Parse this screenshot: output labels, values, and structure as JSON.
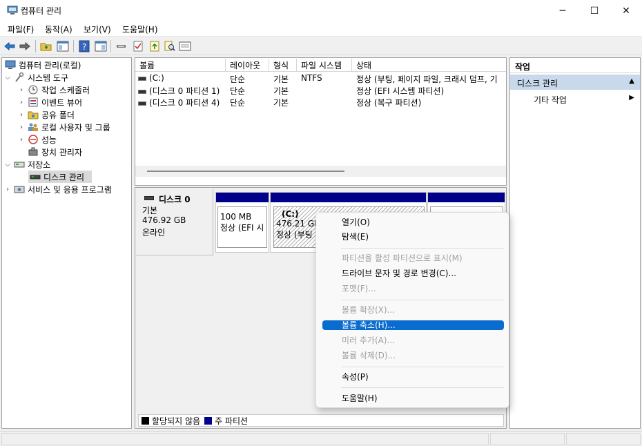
{
  "window": {
    "title": "컴퓨터 관리",
    "minimize_glyph": "─",
    "maximize_glyph": "☐",
    "close_glyph": "✕"
  },
  "menu": [
    "파일(F)",
    "동작(A)",
    "보기(V)",
    "도움말(H)"
  ],
  "tree": {
    "root": "컴퓨터 관리(로컬)",
    "system_tools": "시스템 도구",
    "task_scheduler": "작업 스케줄러",
    "event_viewer": "이벤트 뷰어",
    "shared_folders": "공유 폴더",
    "local_users": "로컬 사용자 및 그룹",
    "performance": "성능",
    "device_manager": "장치 관리자",
    "storage": "저장소",
    "disk_management": "디스크 관리",
    "services": "서비스 및 응용 프로그램"
  },
  "volume_table": {
    "columns": [
      "볼륨",
      "레이아웃",
      "형식",
      "파일 시스템",
      "상태"
    ],
    "rows": [
      [
        "(C:)",
        "단순",
        "기본",
        "NTFS",
        "정상 (부팅, 페이지 파일, 크래시 덤프, 기"
      ],
      [
        "(디스크 0 파티션 1)",
        "단순",
        "기본",
        "",
        "정상 (EFI 시스템 파티션)"
      ],
      [
        "(디스크 0 파티션 4)",
        "단순",
        "기본",
        "",
        "정상 (복구 파티션)"
      ]
    ]
  },
  "disk": {
    "name": "디스크 0",
    "type": "기본",
    "size": "476.92 GB",
    "status": "온라인",
    "partitions": [
      {
        "title": "",
        "size": "100 MB",
        "status": "정상 (EFI 시"
      },
      {
        "title": "(C:)",
        "size": "476.21 GB",
        "status": "정상 (부팅"
      },
      {
        "title": "",
        "size": "",
        "status": ""
      }
    ]
  },
  "legend": {
    "unallocated": "할당되지 않음",
    "primary": "주 파티션",
    "unallocated_color": "#000000",
    "primary_color": "#00008b"
  },
  "actions": {
    "title": "작업",
    "section": "디스크 관리",
    "more": "기타 작업"
  },
  "context_menu": [
    {
      "label": "열기(O)",
      "disabled": false
    },
    {
      "label": "탐색(E)",
      "disabled": false
    },
    {
      "label": "파티션을 활성 파티션으로 표시(M)",
      "disabled": true
    },
    {
      "label": "드라이브 문자 및 경로 변경(C)...",
      "disabled": false
    },
    {
      "label": "포맷(F)...",
      "disabled": true
    },
    {
      "label": "볼륨 확장(X)...",
      "disabled": true
    },
    {
      "label": "볼륨 축소(H)...",
      "disabled": false,
      "highlighted": true
    },
    {
      "label": "미러 추가(A)...",
      "disabled": true
    },
    {
      "label": "볼륨 삭제(D)...",
      "disabled": true
    },
    {
      "label": "속성(P)",
      "disabled": false
    },
    {
      "label": "도움말(H)",
      "disabled": false
    }
  ],
  "colors": {
    "accent": "#0a6cce",
    "partition_bar": "#00008b",
    "action_header": "#c7d9ea"
  }
}
